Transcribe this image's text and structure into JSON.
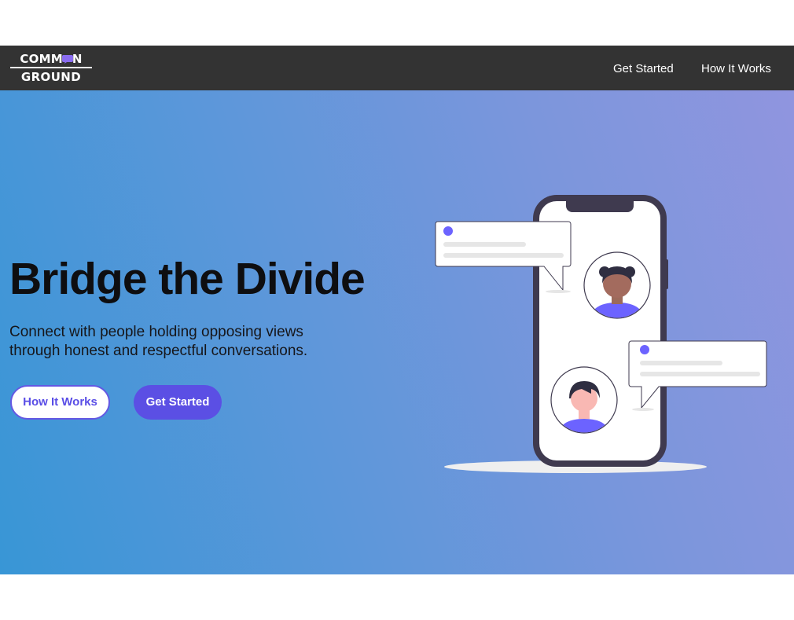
{
  "brand": {
    "line1_left": "COMM",
    "line1_right": "N",
    "line2": "GROUND",
    "bubble_icon": "speech-bubble-icon"
  },
  "nav": {
    "links": [
      {
        "label": "Get Started"
      },
      {
        "label": "How It Works"
      }
    ]
  },
  "hero": {
    "title": "Bridge the Divide",
    "subtitle_line1": "Connect with people holding opposing views",
    "subtitle_line2": "through honest and respectful conversations.",
    "buttons": {
      "how_it_works": "How It Works",
      "get_started": "Get Started"
    },
    "illustration_icon": "phone-chat-illustration"
  },
  "colors": {
    "navbar": "#333333",
    "accent": "#5b4fe4",
    "gradient_start": "#3896d6",
    "gradient_end": "#9095df"
  }
}
